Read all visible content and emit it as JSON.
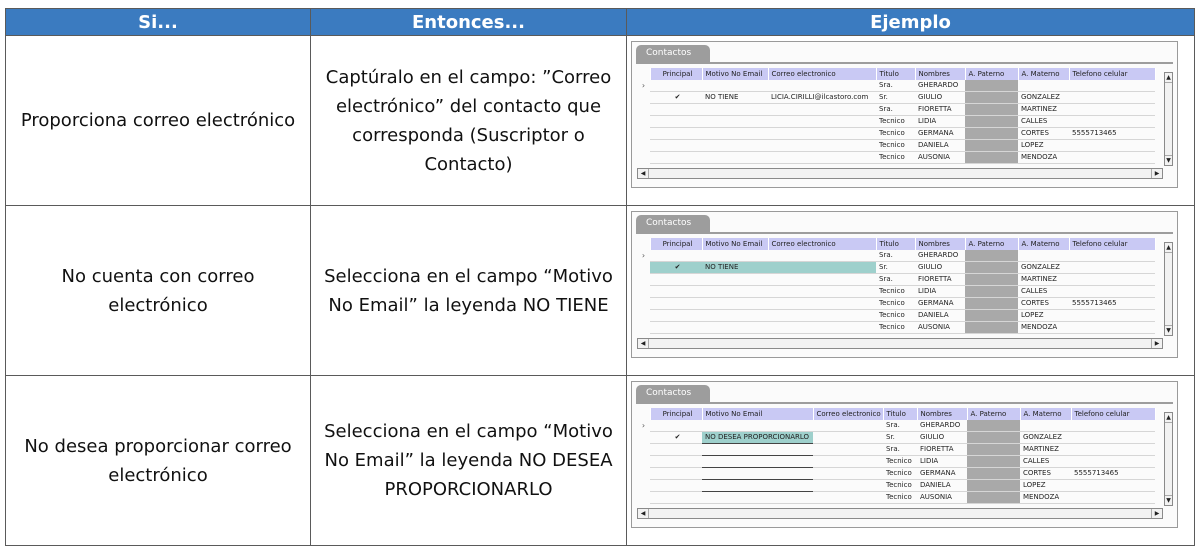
{
  "headers": {
    "condition": "Si...",
    "action": "Entonces...",
    "example": "Ejemplo"
  },
  "rows": [
    {
      "condition": "Proporciona correo electrónico",
      "action": "Captúralo en el campo: ”Correo electrónico” del contacto que corresponda (Suscriptor o Contacto)",
      "example": {
        "tab": "Contactos",
        "columns": [
          "Principal",
          "Motivo No Email",
          "Correo electronico",
          "Titulo",
          "Nombres",
          "A. Paterno",
          "A. Materno",
          "Telefono celular"
        ],
        "rows": [
          [
            "",
            "",
            "",
            "Sra.",
            "GHERARDO",
            "",
            "",
            ""
          ],
          [
            "✔",
            "NO TIENE",
            "LICIA.CIRILLI@ilcastoro.com",
            "Sr.",
            "GIULIO",
            "",
            "GONZALEZ",
            ""
          ],
          [
            "",
            "",
            "",
            "Sra.",
            "FIORETTA",
            "",
            "MARTINEZ",
            ""
          ],
          [
            "",
            "",
            "",
            "Tecnico",
            "LIDIA",
            "",
            "CALLES",
            ""
          ],
          [
            "",
            "",
            "",
            "Tecnico",
            "GERMANA",
            "",
            "CORTES",
            "5555713465"
          ],
          [
            "",
            "",
            "",
            "Tecnico",
            "DANIELA",
            "",
            "LOPEZ",
            ""
          ],
          [
            "",
            "",
            "",
            "Tecnico",
            "AUSONIA",
            "",
            "MENDOZA",
            ""
          ]
        ]
      }
    },
    {
      "condition": "No cuenta con correo electrónico",
      "action": "Selecciona en el campo “Motivo No Email” la leyenda NO TIENE",
      "example": {
        "tab": "Contactos",
        "columns": [
          "Principal",
          "Motivo No Email",
          "Correo electronico",
          "Titulo",
          "Nombres",
          "A. Paterno",
          "A. Materno",
          "Telefono celular"
        ],
        "rows": [
          [
            "",
            "",
            "",
            "Sra.",
            "GHERARDO",
            "",
            "",
            ""
          ],
          [
            "✔",
            "NO TIENE",
            "",
            "Sr.",
            "GIULIO",
            "",
            "GONZALEZ",
            ""
          ],
          [
            "",
            "",
            "",
            "Sra.",
            "FIORETTA",
            "",
            "MARTINEZ",
            ""
          ],
          [
            "",
            "",
            "",
            "Tecnico",
            "LIDIA",
            "",
            "CALLES",
            ""
          ],
          [
            "",
            "",
            "",
            "Tecnico",
            "GERMANA",
            "",
            "CORTES",
            "5555713465"
          ],
          [
            "",
            "",
            "",
            "Tecnico",
            "DANIELA",
            "",
            "LOPEZ",
            ""
          ],
          [
            "",
            "",
            "",
            "Tecnico",
            "AUSONIA",
            "",
            "MENDOZA",
            ""
          ]
        ]
      }
    },
    {
      "condition": "No desea proporcionar correo electrónico",
      "action": "Selecciona en el campo “Motivo No Email” la leyenda NO DESEA PROPORCIONARLO",
      "example": {
        "tab": "Contactos",
        "columns": [
          "Principal",
          "Motivo No Email",
          "Correo electronico",
          "Titulo",
          "Nombres",
          "A. Paterno",
          "A. Materno",
          "Telefono celular"
        ],
        "rows": [
          [
            "",
            "",
            "",
            "Sra.",
            "GHERARDO",
            "",
            "",
            ""
          ],
          [
            "✔",
            "NO DESEA PROPORCIONARLO",
            "",
            "Sr.",
            "GIULIO",
            "",
            "GONZALEZ",
            ""
          ],
          [
            "",
            "",
            "",
            "Sra.",
            "FIORETTA",
            "",
            "MARTINEZ",
            ""
          ],
          [
            "",
            "",
            "",
            "Tecnico",
            "LIDIA",
            "",
            "CALLES",
            ""
          ],
          [
            "",
            "",
            "",
            "Tecnico",
            "GERMANA",
            "",
            "CORTES",
            "5555713465"
          ],
          [
            "",
            "",
            "",
            "Tecnico",
            "DANIELA",
            "",
            "LOPEZ",
            ""
          ],
          [
            "",
            "",
            "",
            "Tecnico",
            "AUSONIA",
            "",
            "MENDOZA",
            ""
          ]
        ]
      }
    }
  ],
  "colors": {
    "header": "#3b7bc0",
    "grid_header": "#c9c9f4",
    "selection": "#9ed0cc",
    "masked": "#a9a9a9"
  },
  "icons": {
    "row_pointer": "chevron-right-icon",
    "check": "check-icon",
    "scroll_up": "arrow-up-icon",
    "scroll_down": "arrow-down-icon",
    "scroll_left": "arrow-left-icon",
    "scroll_right": "arrow-right-icon"
  }
}
